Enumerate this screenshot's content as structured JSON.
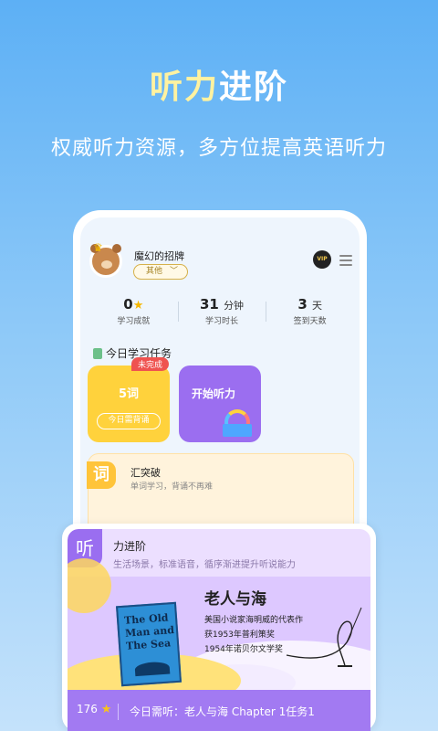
{
  "promo": {
    "headline_part1": "听力",
    "headline_part2": "进阶",
    "subtitle": "权威听力资源，多方位提高英语听力"
  },
  "profile": {
    "username": "魔幻的招牌",
    "tag": "其他",
    "vip_label": "VIP"
  },
  "stats": [
    {
      "value": "0",
      "unit": "",
      "label": "学习成就",
      "icon": "star-icon"
    },
    {
      "value": "31",
      "unit": "分钟",
      "label": "学习时长"
    },
    {
      "value": "3",
      "unit": "天",
      "label": "签到天数"
    }
  ],
  "today_tasks": {
    "title": "今日学习任务",
    "word_card": {
      "badge": "未完成",
      "count": "5词",
      "button": "今日需背诵"
    },
    "listen_card": {
      "label": "开始听力"
    }
  },
  "vocab_card": {
    "icon": "词",
    "title": "汇突破",
    "subtitle": "单词学习，背诵不再难"
  },
  "listening_popup": {
    "icon": "听",
    "title": "力进阶",
    "subtitle": "生活场景，标准语音，循序渐进提升听说能力",
    "book_cover_text": "The Old Man and The Sea",
    "book_title": "老人与海",
    "book_lines": [
      "美国小说家海明威的代表作",
      "获1953年普利策奖",
      "1954年诺贝尔文学奖"
    ],
    "star_count": "176",
    "today_label": "今日需听：老人与海 Chapter 1任务1"
  },
  "colors": {
    "accent_yellow": "#ffd23c",
    "accent_purple": "#9b6ef0",
    "badge_red": "#ef5350"
  }
}
